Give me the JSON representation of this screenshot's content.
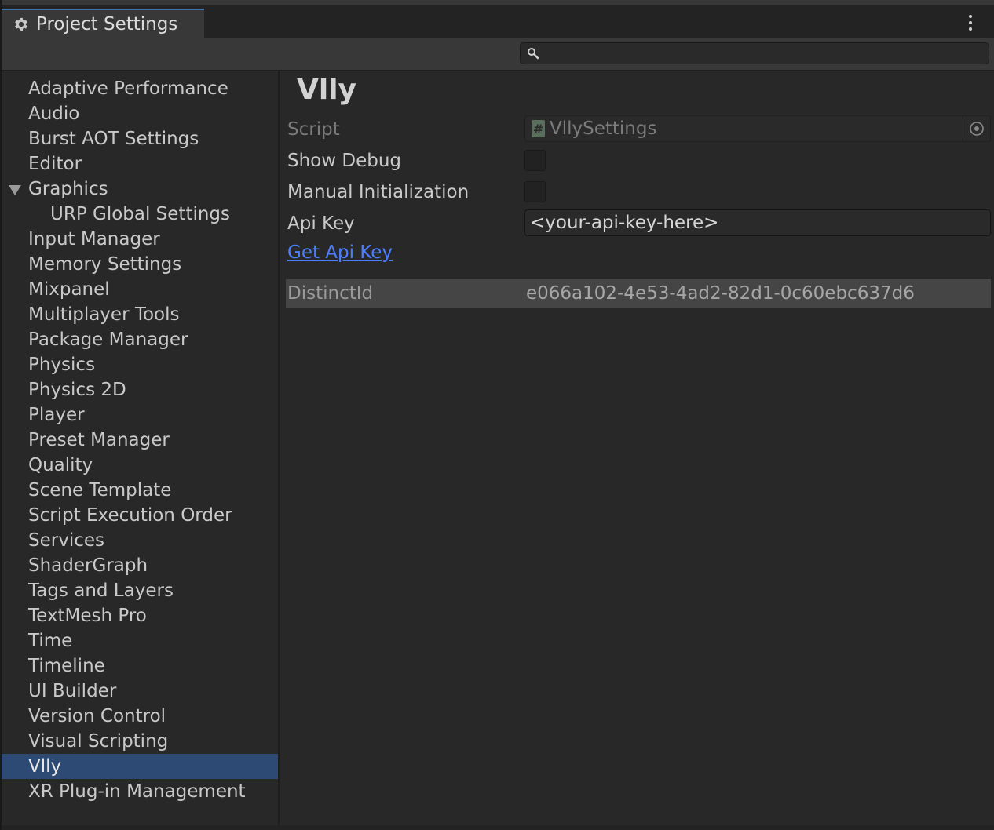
{
  "window": {
    "tab_title": "Project Settings",
    "search": {
      "value": "",
      "placeholder": ""
    }
  },
  "sidebar": {
    "items": [
      {
        "label": "Adaptive Performance"
      },
      {
        "label": "Audio"
      },
      {
        "label": "Burst AOT Settings"
      },
      {
        "label": "Editor"
      },
      {
        "label": "Graphics",
        "expanded": true
      },
      {
        "label": "URP Global Settings",
        "indent": 1
      },
      {
        "label": "Input Manager"
      },
      {
        "label": "Memory Settings"
      },
      {
        "label": "Mixpanel"
      },
      {
        "label": "Multiplayer Tools"
      },
      {
        "label": "Package Manager"
      },
      {
        "label": "Physics"
      },
      {
        "label": "Physics 2D"
      },
      {
        "label": "Player"
      },
      {
        "label": "Preset Manager"
      },
      {
        "label": "Quality"
      },
      {
        "label": "Scene Template"
      },
      {
        "label": "Script Execution Order"
      },
      {
        "label": "Services"
      },
      {
        "label": "ShaderGraph"
      },
      {
        "label": "Tags and Layers"
      },
      {
        "label": "TextMesh Pro"
      },
      {
        "label": "Time"
      },
      {
        "label": "Timeline"
      },
      {
        "label": "UI Builder"
      },
      {
        "label": "Version Control"
      },
      {
        "label": "Visual Scripting"
      },
      {
        "label": "Vlly",
        "selected": true
      },
      {
        "label": "XR Plug-in Management"
      }
    ]
  },
  "panel": {
    "title": "Vlly",
    "script": {
      "label": "Script",
      "value": "VllySettings",
      "icon": "script-icon"
    },
    "show_debug": {
      "label": "Show Debug",
      "checked": false
    },
    "manual_init": {
      "label": "Manual Initialization",
      "checked": false
    },
    "api_key": {
      "label": "Api Key",
      "value": "<your-api-key-here>"
    },
    "get_api_key_link": "Get Api Key",
    "distinct_id": {
      "label": "DistinctId",
      "value": "e066a102-4e53-4ad2-82d1-0c60ebc637d6"
    }
  },
  "colors": {
    "selection": "#2c4a73",
    "link": "#4c7eff",
    "tab_accent": "#3a72b0"
  }
}
